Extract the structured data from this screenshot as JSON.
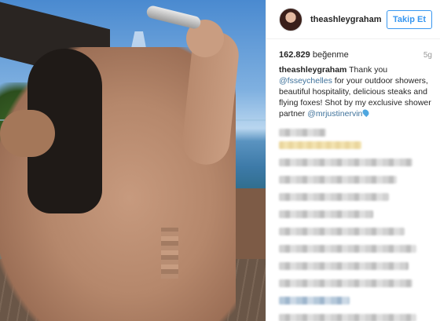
{
  "post": {
    "username": "theashleygraham",
    "follow_label": "Takip Et",
    "likes_count": "162.829",
    "likes_label": "beğenme",
    "time_ago": "5g",
    "caption": {
      "user": "theashleygraham",
      "text_1": " Thank you ",
      "mention_1": "@fsseychelles",
      "text_2": " for your outdoor showers, beautiful hospitality, delicious steaks and flying foxes! Shot by my exclusive shower partner ",
      "mention_2": "@mrjustinervin"
    },
    "icons": {
      "avatar": "profile-avatar",
      "drop": "droplet-emoji"
    }
  },
  "colors": {
    "accent": "#3897f0",
    "mention": "#3f729b"
  }
}
